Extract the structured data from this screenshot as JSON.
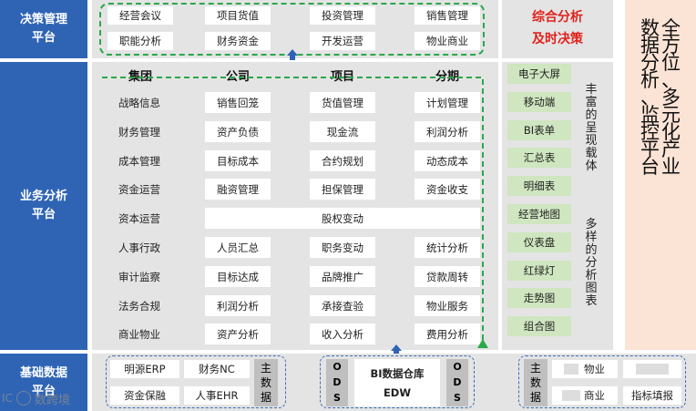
{
  "sections": {
    "decision_line1": "决策管理",
    "decision_line2": "平台",
    "business_line1": "业务分析",
    "business_line2": "平台",
    "base_line1": "基础数据",
    "base_line2": "平台"
  },
  "decision_items": [
    "经营会议",
    "项目货值",
    "投资管理",
    "销售管理",
    "职能分析",
    "财务资金",
    "开发运营",
    "物业商业"
  ],
  "decision_caption_line1": "综合分析",
  "decision_caption_line2": "及时决策",
  "table_headers": [
    "集团",
    "公司",
    "项目",
    "分期"
  ],
  "table_rows": [
    [
      "战略信息",
      "销售回笼",
      "货值管理",
      "计划管理"
    ],
    [
      "财务管理",
      "资产负债",
      "现金流",
      "利润分析"
    ],
    [
      "成本管理",
      "目标成本",
      "合约规划",
      "动态成本"
    ],
    [
      "资金运营",
      "融资管理",
      "担保管理",
      "资金收支"
    ],
    [
      "资本运营",
      "股权变动"
    ],
    [
      "人事行政",
      "人员汇总",
      "职务变动",
      "统计分析"
    ],
    [
      "审计监察",
      "目标达成",
      "品牌推广",
      "贷款周转"
    ],
    [
      "法务合规",
      "利润分析",
      "承接查验",
      "物业服务"
    ],
    [
      "商业物业",
      "资产分析",
      "收入分析",
      "费用分析"
    ]
  ],
  "carriers": [
    "电子大屏",
    "移动端",
    "BI表单",
    "汇总表",
    "明细表",
    "经营地图",
    "仪表盘",
    "红绿灯",
    "走势图",
    "组合图"
  ],
  "carrier_caption_1": "丰富的呈现载体",
  "carrier_caption_2": "多样的分析图表",
  "big_title": "全方位、多元化产业数据分析、监控平台",
  "base": {
    "left_items": [
      "明源ERP",
      "财务NC",
      "资金保融",
      "人事EHR"
    ],
    "main_data": "主数据",
    "ods": "ODS",
    "dw_line1": "BI数据仓库",
    "dw_line2": "EDW",
    "right_items": [
      "物业",
      "商业",
      "指标填报"
    ]
  },
  "watermark": "数跨境",
  "watermark_prefix": "IC"
}
